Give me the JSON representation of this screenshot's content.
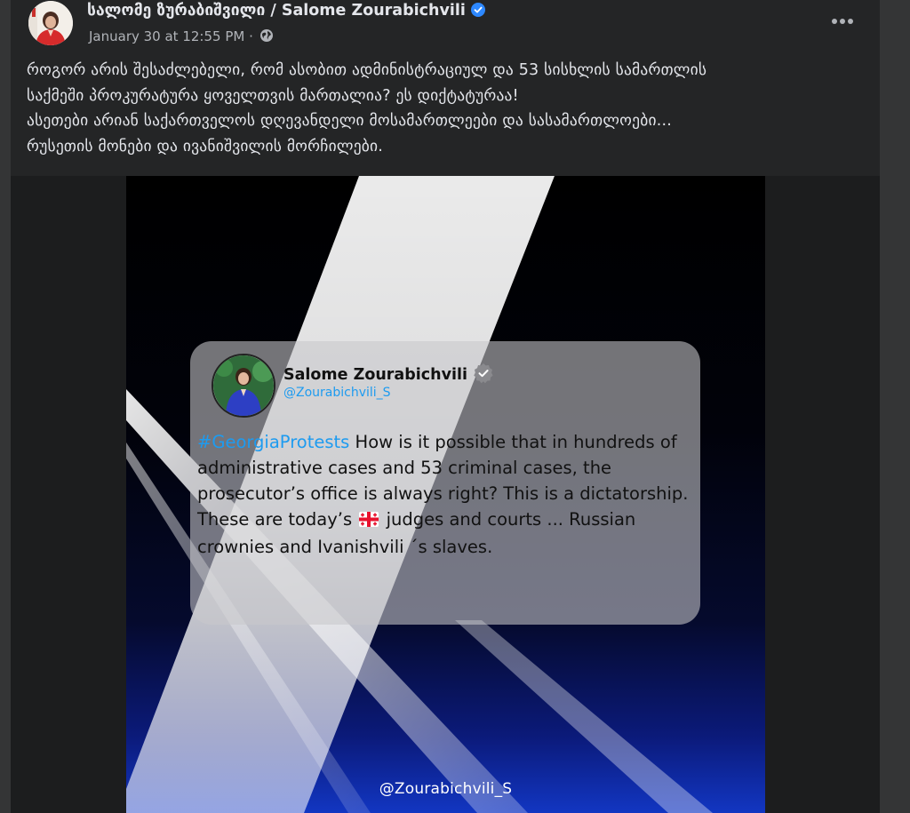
{
  "post": {
    "author": "სალომე ზურაბიშვილი / Salome Zourabichvili",
    "timestamp": "January 30 at 12:55 PM",
    "separator": "·",
    "caption_lines": [
      "როგორ არის შესაძლებელი, რომ ასობით ადმინისტრაციულ და 53 სისხლის სამართლის",
      "საქმეში პროკურატურა ყოველთვის მართალია? ეს დიქტატურაა!",
      "ასეთები არიან საქართველოს დღევანდელი მოსამართლეები და სასამართლოები...",
      "რუსეთის მონები და ივანიშვილის მორჩილები."
    ],
    "more_icon": "more-horizontal-icon",
    "audience_icon": "globe-icon",
    "verified_icon": "verified-badge-icon"
  },
  "image": {
    "tweet": {
      "name": "Salome Zourabichvili",
      "handle": "@Zourabichvili_S",
      "hashtag": "#GeorgiaProtests",
      "text_part1": " How is it possible that in hundreds of administrative cases and 53 criminal cases, the prosecutor’s office is always right? This is a dictatorship.",
      "text_part2_pre": "These are today’s",
      "flag_icon": "georgia-flag-icon",
      "text_part2_post": "judges and courts ... Russian crownies and Ivanishvili ´s slaves."
    },
    "watermark": "@Zourabichvili_S"
  },
  "colors": {
    "post_bg": "#242526",
    "page_bg": "#343536",
    "hashtag": "#1d9bf0",
    "verified": "#2d88ff"
  }
}
